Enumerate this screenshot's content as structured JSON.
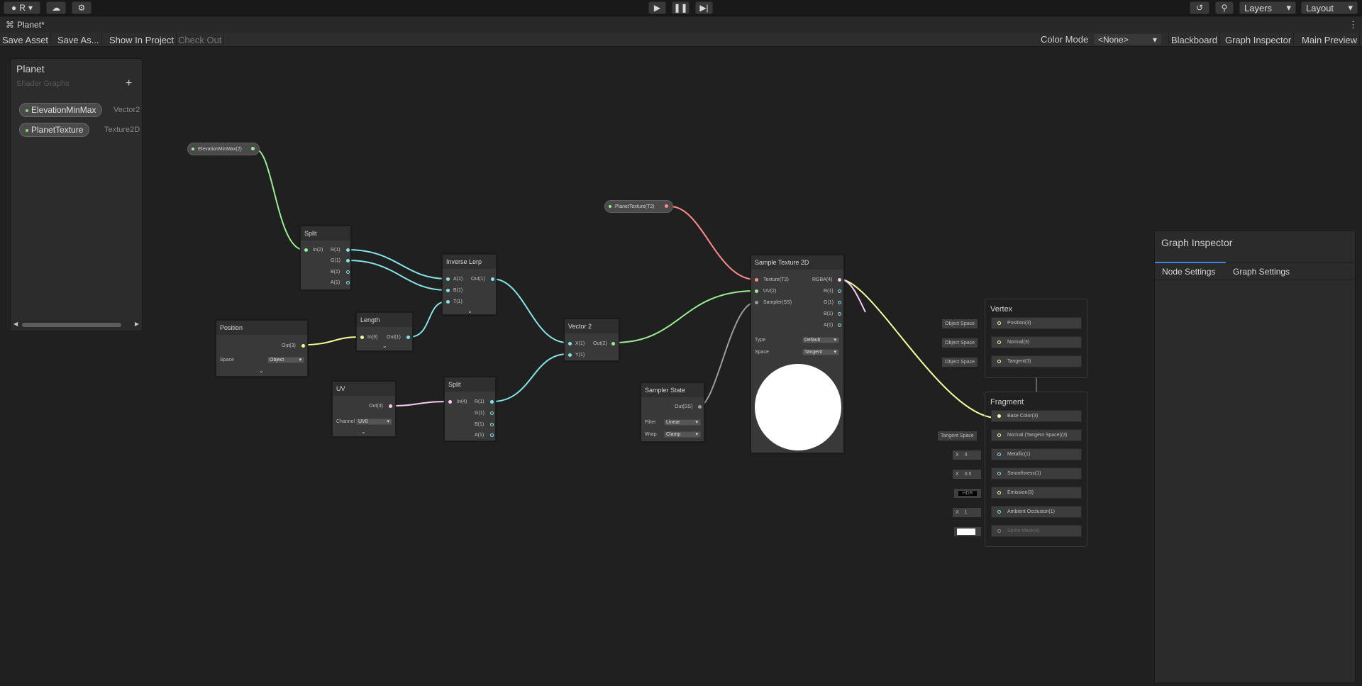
{
  "topbar": {
    "account_label": "R",
    "layers_label": "Layers",
    "layout_label": "Layout"
  },
  "tab": {
    "title": "Planet*"
  },
  "toolbar": {
    "save_asset": "Save Asset",
    "save_as": "Save As...",
    "show_in_project": "Show In Project",
    "check_out": "Check Out",
    "color_mode_label": "Color Mode",
    "color_mode_value": "<None>",
    "blackboard": "Blackboard",
    "graph_inspector": "Graph Inspector",
    "main_preview": "Main Preview"
  },
  "blackboard": {
    "title": "Planet",
    "subtitle": "Shader Graphs",
    "properties": [
      {
        "name": "ElevationMinMax",
        "type": "Vector2"
      },
      {
        "name": "PlanetTexture",
        "type": "Texture2D"
      }
    ]
  },
  "nodes": {
    "elevation_prop": "ElevationMinMax(2)",
    "planet_prop": "PlanetTexture(T2)",
    "split1": {
      "title": "Split",
      "in": "In(2)",
      "outs": [
        "R(1)",
        "G(1)",
        "B(1)",
        "A(1)"
      ]
    },
    "inverse_lerp": {
      "title": "Inverse Lerp",
      "ins": [
        "A(1)",
        "B(1)",
        "T(1)"
      ],
      "out": "Out(1)"
    },
    "position": {
      "title": "Position",
      "out": "Out(3)",
      "space_label": "Space",
      "space_value": "Object"
    },
    "length": {
      "title": "Length",
      "in": "In(3)",
      "out": "Out(1)"
    },
    "uv": {
      "title": "UV",
      "out": "Out(4)",
      "channel_label": "Channel",
      "channel_value": "UV0"
    },
    "split2": {
      "title": "Split",
      "in": "In(4)",
      "outs": [
        "R(1)",
        "G(1)",
        "B(1)",
        "A(1)"
      ]
    },
    "vector2": {
      "title": "Vector 2",
      "ins": [
        "X(1)",
        "Y(1)"
      ],
      "out": "Out(2)"
    },
    "sampler_state": {
      "title": "Sampler State",
      "out": "Out(SS)",
      "filter_label": "Filter",
      "filter_value": "Linear",
      "wrap_label": "Wrap",
      "wrap_value": "Clamp"
    },
    "sample_texture": {
      "title": "Sample Texture 2D",
      "ins": [
        "Texture(T2)",
        "UV(2)",
        "Sampler(SS)"
      ],
      "outs": [
        "RGBA(4)",
        "R(1)",
        "G(1)",
        "B(1)",
        "A(1)"
      ],
      "type_label": "Type",
      "type_value": "Default",
      "space_label": "Space",
      "space_value": "Tangent"
    }
  },
  "master": {
    "vertex_title": "Vertex",
    "vertex_slots": [
      {
        "pin": "Object Space",
        "label": "Position(3)"
      },
      {
        "pin": "Object Space",
        "label": "Normal(3)"
      },
      {
        "pin": "Object Space",
        "label": "Tangent(3)"
      }
    ],
    "fragment_title": "Fragment",
    "fragment_slots": [
      {
        "pin": "",
        "label": "Base Color(3)"
      },
      {
        "pin": "Tangent Space",
        "label": "Normal (Tangent Space)(3)"
      },
      {
        "pin": "0",
        "pin_prefix": "X",
        "label": "Metallic(1)"
      },
      {
        "pin": "0.5",
        "pin_prefix": "X",
        "label": "Smoothness(1)"
      },
      {
        "pin": "HDR",
        "label": "Emission(3)"
      },
      {
        "pin": "1",
        "pin_prefix": "X",
        "label": "Ambient Occlusion(1)"
      },
      {
        "pin": "",
        "label": "Sprite Mask(4)"
      }
    ]
  },
  "inspector": {
    "title": "Graph Inspector",
    "tabs": [
      "Node Settings",
      "Graph Settings"
    ]
  },
  "colors": {
    "vector1": "#84e4e7",
    "vector2": "#9aef92",
    "vector3": "#f6ff9a",
    "vector4": "#fbcbf4",
    "texture": "#ff8b8b",
    "sampler": "#9c9c9c",
    "accent": "#3d83e0"
  }
}
